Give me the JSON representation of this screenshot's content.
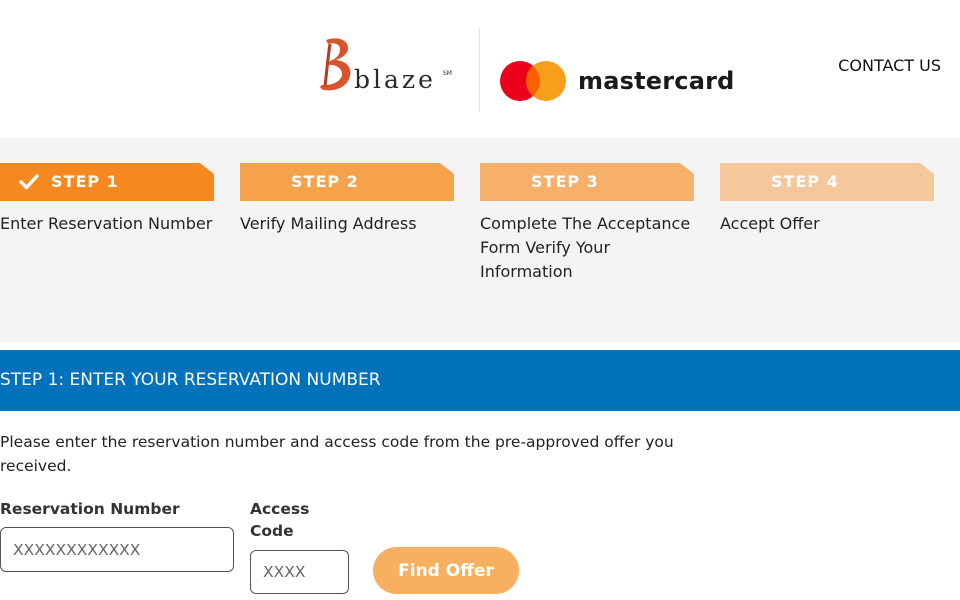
{
  "header": {
    "brand_blaze": "blaze",
    "brand_blaze_mark": "SM",
    "brand_mastercard": "mastercard",
    "contact_label": "CONTACT US"
  },
  "colors": {
    "accent_orange": "#f5891f",
    "step2_orange": "#f6a24a",
    "step3_orange": "#f6b06a",
    "step4_orange": "#f6c79b",
    "section_blue": "#0071bb",
    "button_orange": "#f6b060",
    "mc_red": "#eb001b",
    "mc_yellow": "#f79e1b"
  },
  "steps": [
    {
      "label": "STEP 1",
      "description": "Enter Reservation Number",
      "completed": true,
      "icon": "check-icon"
    },
    {
      "label": "STEP 2",
      "description": "Verify Mailing Address",
      "completed": false
    },
    {
      "label": "STEP 3",
      "description": "Complete The Acceptance Form Verify Your Information",
      "completed": false
    },
    {
      "label": "STEP 4",
      "description": "Accept Offer",
      "completed": false
    }
  ],
  "section": {
    "title": "STEP 1: ENTER YOUR RESERVATION NUMBER"
  },
  "form": {
    "intro": "Please enter the reservation number and access code from the pre-approved offer you received.",
    "reservation_label": "Reservation Number",
    "reservation_placeholder": "XXXXXXXXXXXX",
    "reservation_value": "",
    "access_label_line1": "Access",
    "access_label_line2": "Code",
    "access_placeholder": "XXXX",
    "access_value": "",
    "submit_label": "Find Offer"
  }
}
